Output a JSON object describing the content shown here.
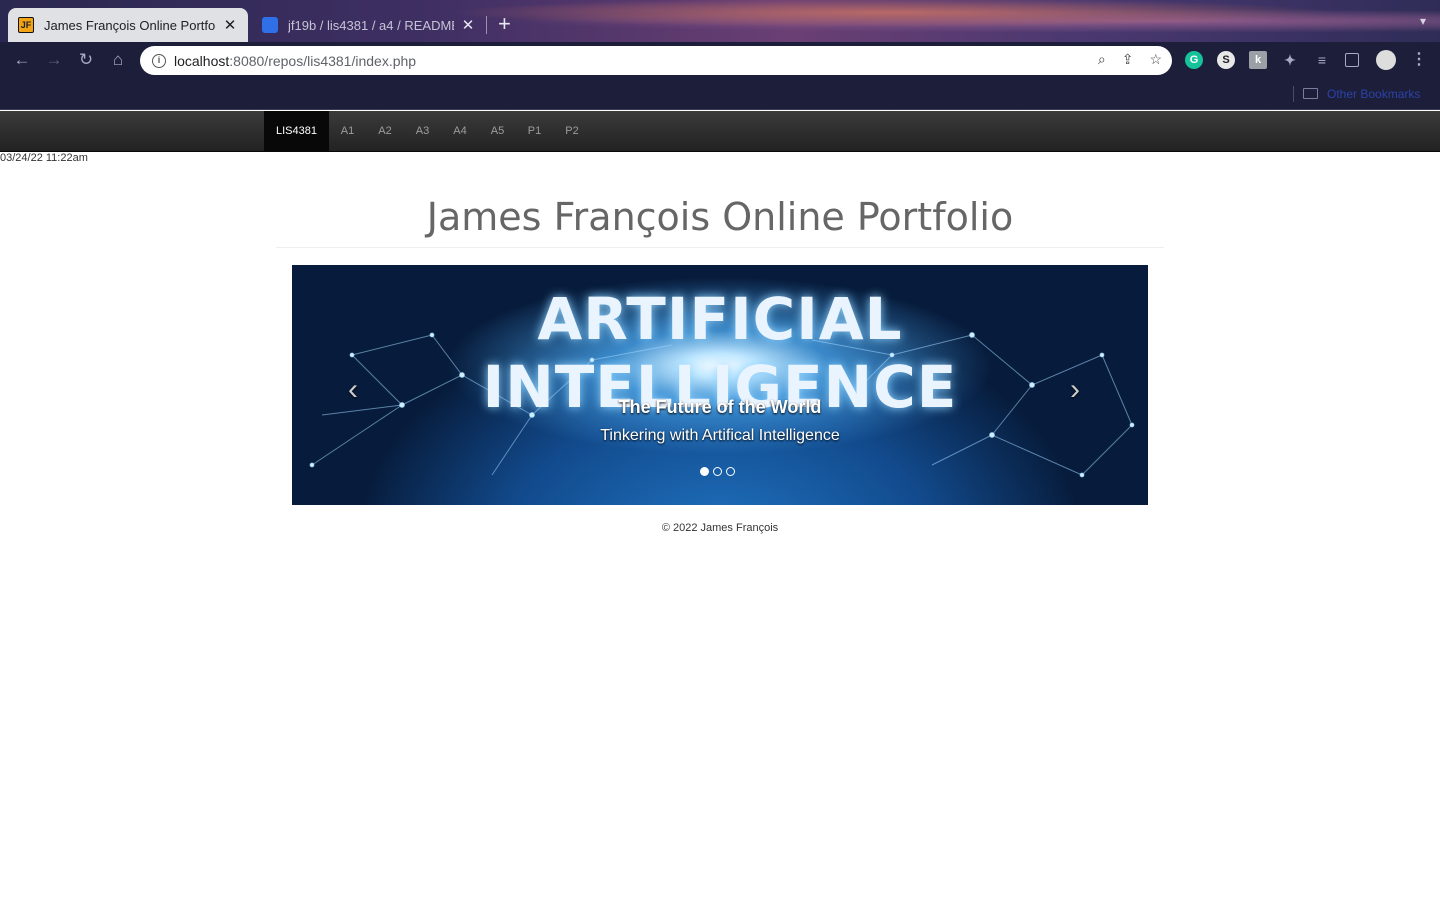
{
  "browser": {
    "tabs": [
      {
        "title": "James François Online Portfolio",
        "favicon": "JF",
        "active": true
      },
      {
        "title": "jf19b / lis4381 / a4 / README",
        "active": false
      }
    ],
    "address": {
      "host": "localhost",
      "path": ":8080/repos/lis4381/index.php"
    },
    "bookmark_folder": "Other Bookmarks"
  },
  "page": {
    "nav_items": [
      "LIS4381",
      "A1",
      "A2",
      "A3",
      "A4",
      "A5",
      "P1",
      "P2"
    ],
    "timestamp": "03/24/22 11:22am",
    "heading": "James François Online Portfolio",
    "carousel": {
      "banner_text": "ARTIFICIAL INTELLIGENCE",
      "caption_title": "The Future of the World",
      "caption_text": "Tinkering with Artifical Intelligence",
      "slide_count": 3,
      "active_slide": 1
    },
    "footer": "© 2022 James François"
  }
}
